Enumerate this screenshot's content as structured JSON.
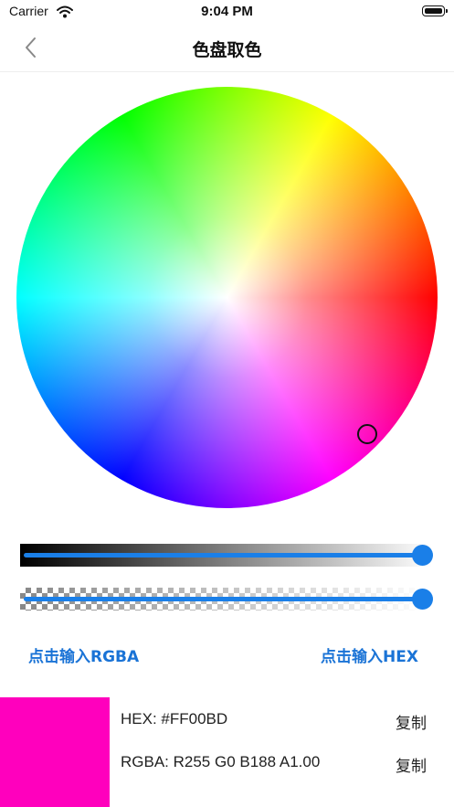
{
  "status_bar": {
    "carrier": "Carrier",
    "time": "9:04 PM"
  },
  "nav": {
    "title": "色盘取色"
  },
  "sliders": {
    "brightness_level": 1.0,
    "alpha_level": 1.0
  },
  "actions": {
    "rgba_input_label": "点击输入RGBA",
    "hex_input_label": "点击输入HEX"
  },
  "result": {
    "color": "#FF00BD",
    "hex_text": "HEX:  #FF00BD",
    "rgba_text": "RGBA:  R255 G0 B188 A1.00",
    "copy_label": "复制"
  },
  "accent_color": "#1a7fe8"
}
